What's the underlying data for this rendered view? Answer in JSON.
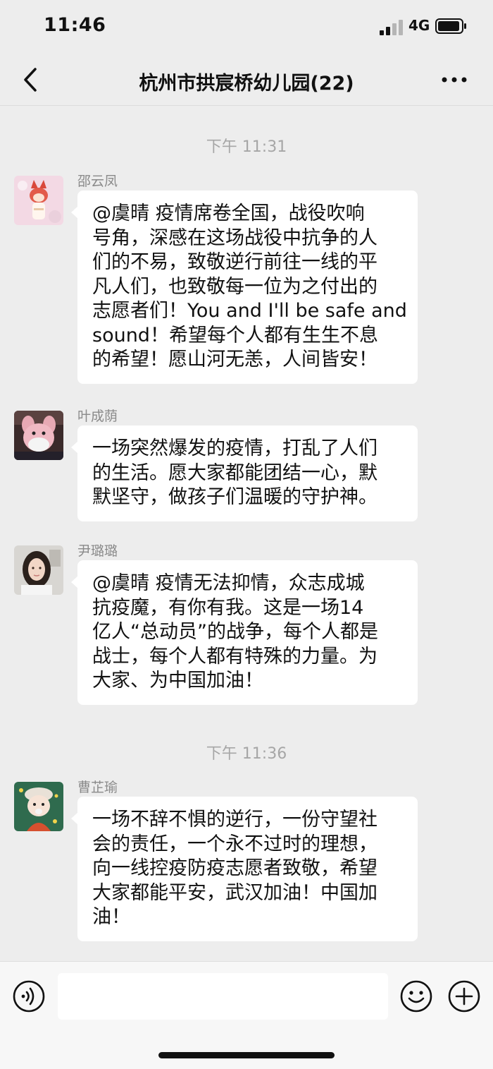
{
  "status_bar": {
    "time": "11:46",
    "network": "4G",
    "signal_icon": "signal-bars-icon",
    "battery_icon": "battery-icon"
  },
  "nav": {
    "back_icon": "chevron-left-icon",
    "title": "杭州市拱宸桥幼儿园(22)",
    "more_icon": "more-dots-icon"
  },
  "chat": {
    "timestamps": [
      "下午 11:31",
      "下午 11:36"
    ],
    "messages": [
      {
        "sender": "邵云凤",
        "avatar": "cartoon-fox-avatar",
        "lines": [
          "@虞晴 疫情席卷全国，战役吹响",
          "号角，深感在这场战役中抗争的人",
          "们的不易，致敬逆行前往一线的平",
          "凡人们，也致敬每一位为之付出的",
          "志愿者们！You and I'll be safe and",
          " sound！希望每个人都有生生不息",
          "的希望！愿山河无恙，人间皆安！"
        ]
      },
      {
        "sender": "叶成荫",
        "avatar": "plush-toy-mask-avatar",
        "lines": [
          "一场突然爆发的疫情，打乱了人们",
          "的生活。愿大家都能团结一心，默",
          "默坚守，做孩子们温暖的守护神。"
        ]
      },
      {
        "sender": "尹璐璐",
        "avatar": "woman-photo-avatar",
        "lines": [
          "@虞晴 疫情无法抑情，众志成城",
          "抗疫魔，有你有我。这是一场14",
          "亿人“总动员”的战争，每个人都是",
          "战士，每个人都有特殊的力量。为",
          "大家、为中国加油！"
        ]
      },
      {
        "sender": "曹芷瑜",
        "avatar": "cartoon-girl-avatar",
        "lines": [
          "一场不辞不惧的逆行，一份守望社",
          "会的责任，一个永不过时的理想，",
          "向一线控疫防疫志愿者致敬，希望",
          "大家都能平安，武汉加油！中国加",
          "油！"
        ]
      }
    ]
  },
  "input_bar": {
    "voice_icon": "voice-icon",
    "emoji_icon": "emoji-icon",
    "plus_icon": "plus-icon",
    "input_value": ""
  }
}
